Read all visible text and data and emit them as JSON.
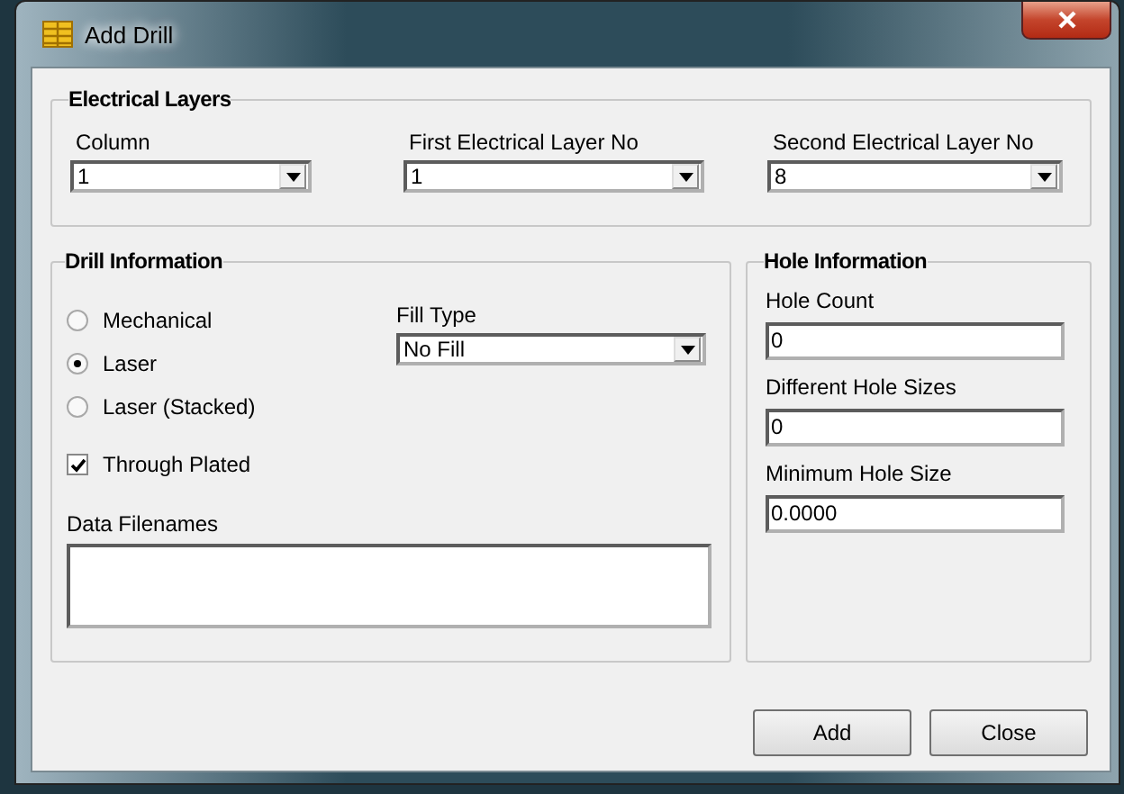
{
  "window": {
    "title": "Add Drill"
  },
  "electrical_layers": {
    "title": "Electrical Layers",
    "fields": [
      {
        "label": "Column",
        "value": "1"
      },
      {
        "label": "First Electrical Layer No",
        "value": "1"
      },
      {
        "label": "Second Electrical Layer No",
        "value": "8"
      }
    ]
  },
  "drill_information": {
    "title": "Drill Information",
    "drill_types": [
      {
        "label": "Mechanical",
        "selected": false
      },
      {
        "label": "Laser",
        "selected": true
      },
      {
        "label": "Laser (Stacked)",
        "selected": false
      }
    ],
    "through_plated": {
      "label": "Through Plated",
      "checked": true
    },
    "fill_type": {
      "label": "Fill Type",
      "value": "No Fill"
    },
    "data_filenames": {
      "label": "Data Filenames"
    }
  },
  "hole_information": {
    "title": "Hole Information",
    "fields": [
      {
        "label": "Hole Count",
        "value": "0"
      },
      {
        "label": "Different Hole Sizes",
        "value": "0"
      },
      {
        "label": "Minimum Hole Size",
        "value": "0.0000"
      }
    ]
  },
  "buttons": [
    "Add",
    "Close"
  ]
}
